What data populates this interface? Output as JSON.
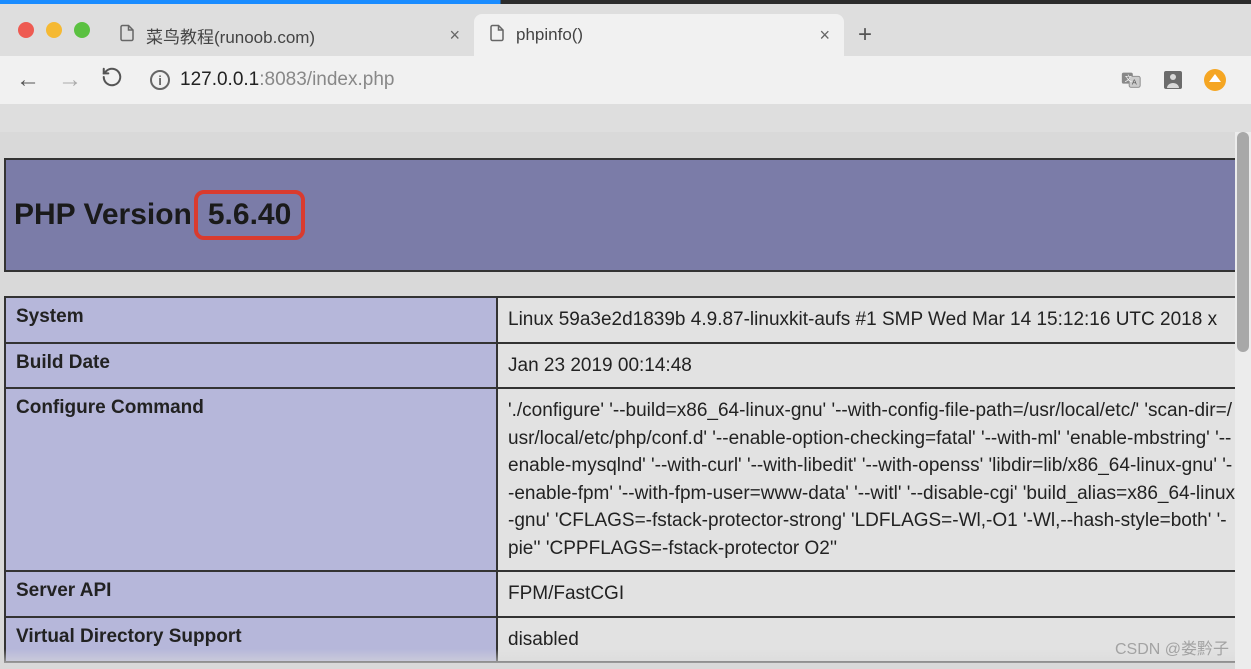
{
  "browser": {
    "tabs": [
      {
        "title": "菜鸟教程(runoob.com)",
        "active": false
      },
      {
        "title": "phpinfo()",
        "active": true
      }
    ],
    "address": {
      "host": "127.0.0.1",
      "port": ":8083",
      "path": "/index.php"
    }
  },
  "phpinfo": {
    "version_label": "PHP Version",
    "version_value": "5.6.40",
    "rows": [
      {
        "label": "System",
        "value": "Linux 59a3e2d1839b 4.9.87-linuxkit-aufs #1 SMP Wed Mar 14 15:12:16 UTC 2018 x"
      },
      {
        "label": "Build Date",
        "value": "Jan 23 2019 00:14:48"
      },
      {
        "label": "Configure Command",
        "value": "'./configure' '--build=x86_64-linux-gnu' '--with-config-file-path=/usr/local/etc/' 'scan-dir=/usr/local/etc/php/conf.d' '--enable-option-checking=fatal' '--with-ml' 'enable-mbstring' '--enable-mysqlnd' '--with-curl' '--with-libedit' '--with-openss' 'libdir=lib/x86_64-linux-gnu' '--enable-fpm' '--with-fpm-user=www-data' '--witl' '--disable-cgi' 'build_alias=x86_64-linux-gnu' 'CFLAGS=-fstack-protector-strong' 'LDFLAGS=-Wl,-O1 '-Wl,--hash-style=both' '-pie'' 'CPPFLAGS=-fstack-protector O2''"
      },
      {
        "label": "Server API",
        "value": "FPM/FastCGI"
      },
      {
        "label": "Virtual Directory Support",
        "value": "disabled"
      }
    ]
  },
  "watermark": "CSDN @娄黔子"
}
